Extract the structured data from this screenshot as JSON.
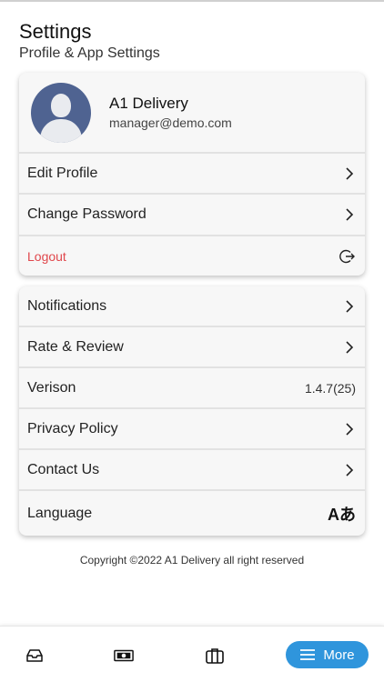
{
  "header": {
    "title": "Settings",
    "subtitle": "Profile & App Settings"
  },
  "profile": {
    "name": "A1 Delivery",
    "email": "manager@demo.com"
  },
  "account_menu": {
    "edit_profile": "Edit Profile",
    "change_password": "Change Password",
    "logout": "Logout"
  },
  "app_menu": {
    "notifications": "Notifications",
    "rate_review": "Rate & Review",
    "version_label": "Verison",
    "version_value": "1.4.7(25)",
    "privacy_policy": "Privacy Policy",
    "contact_us": "Contact Us",
    "language": "Language",
    "language_icon_text": "Aあ"
  },
  "footer": {
    "copyright": "Copyright ©2022 A1 Delivery all right reserved"
  },
  "bottom_nav": {
    "more_label": "More",
    "icons": [
      "inbox-icon",
      "cash-icon",
      "briefcase-icon",
      "menu-icon"
    ]
  },
  "colors": {
    "accent": "#2f95dc",
    "logout": "#e0474c",
    "avatar": "#4f6391"
  }
}
